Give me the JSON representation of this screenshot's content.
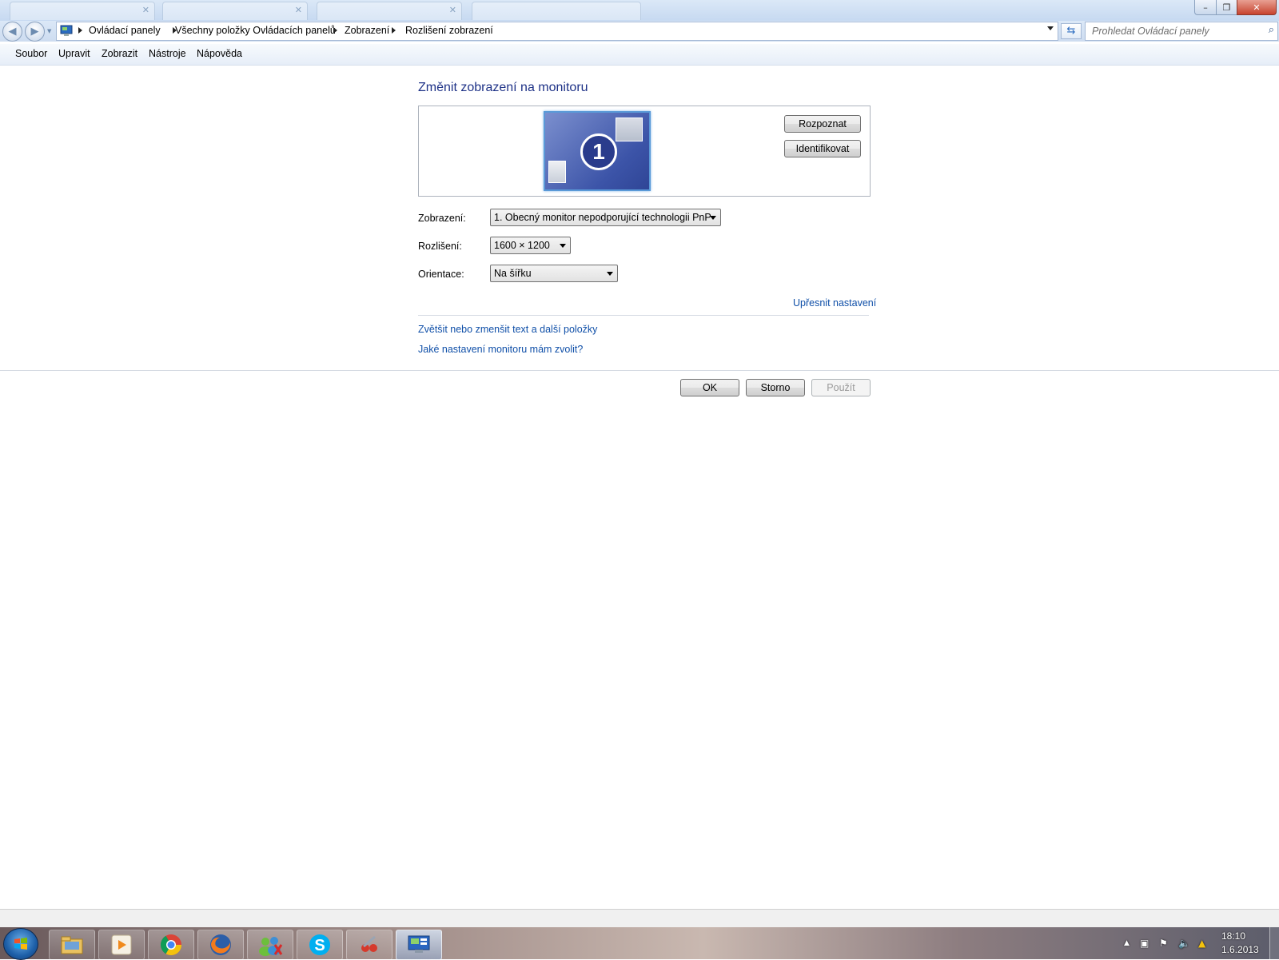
{
  "window": {
    "controls": {
      "minimize": "–",
      "maximize": "❐",
      "close": "✕"
    }
  },
  "address": {
    "breadcrumbs": [
      "Ovládací panely",
      "Všechny položky Ovládacích panelů",
      "Zobrazení",
      "Rozlišení zobrazení"
    ],
    "search_placeholder": "Prohledat Ovládací panely"
  },
  "menu": [
    "Soubor",
    "Upravit",
    "Zobrazit",
    "Nástroje",
    "Nápověda"
  ],
  "main": {
    "title": "Změnit zobrazení na monitoru",
    "monitor_number": "1",
    "detect_button": "Rozpoznat",
    "identify_button": "Identifikovat",
    "display_label": "Zobrazení:",
    "display_value": "1. Obecný monitor nepodporující technologii PnP",
    "resolution_label": "Rozlišení:",
    "resolution_value": "1600 × 1200",
    "orientation_label": "Orientace:",
    "orientation_value": "Na šířku",
    "advanced_link": "Upřesnit nastavení",
    "text_size_link": "Zvětšit nebo zmenšit text a další položky",
    "monitor_help_link": "Jaké nastavení monitoru mám zvolit?",
    "ok_button": "OK",
    "cancel_button": "Storno",
    "apply_button": "Použít"
  },
  "taskbar": {
    "apps": [
      "explorer-icon",
      "media-player-icon",
      "chrome-icon",
      "firefox-icon",
      "messenger-icon",
      "skype-icon",
      "app-icon",
      "control-panel-icon"
    ],
    "time": "18:10",
    "date": "1.6.2013"
  }
}
